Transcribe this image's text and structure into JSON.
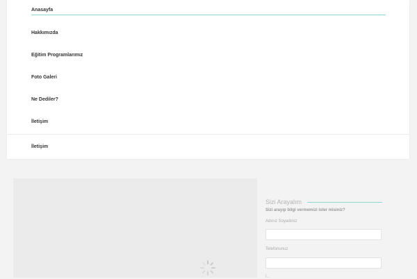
{
  "nav": {
    "items": [
      {
        "label": "Anasayfa"
      },
      {
        "label": "Hakkımızda"
      },
      {
        "label": "Eğitim Programlarımız"
      },
      {
        "label": "Foto Galeri"
      },
      {
        "label": "Ne Dediler?"
      },
      {
        "label": "İletişim"
      }
    ],
    "secondary_label": "İletişim",
    "active_index": 0
  },
  "callback_form": {
    "title": "Sizi Arayalım",
    "subtitle": "Sizi arayıp bilgi vermemizi ister misiniz?",
    "fields": [
      {
        "label": "Adınız Soyadınız",
        "value": ""
      },
      {
        "label": "Telefonunuz",
        "value": ""
      }
    ],
    "partial_label": "İ..."
  },
  "colors": {
    "accent": "#8fd8d2",
    "background": "#f3f3f3",
    "panel": "#ffffff"
  }
}
